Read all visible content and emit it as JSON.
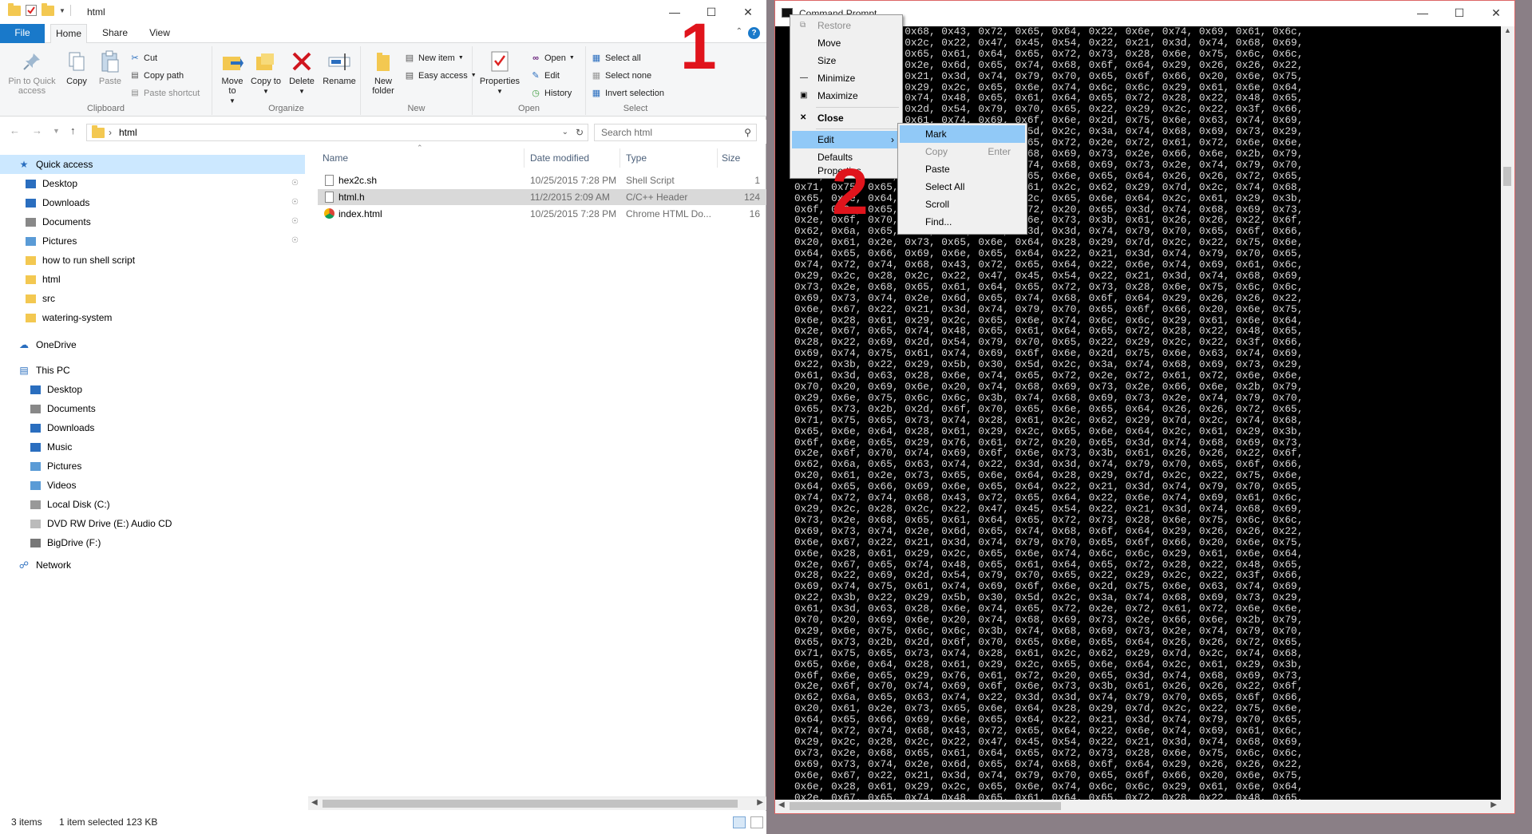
{
  "explorer": {
    "title": "html",
    "tabs": [
      "File",
      "Home",
      "Share",
      "View"
    ],
    "ribbon": {
      "clipboard": {
        "pin": "Pin to Quick access",
        "copy": "Copy",
        "paste": "Paste",
        "cut": "Cut",
        "copy_path": "Copy path",
        "paste_shortcut": "Paste shortcut",
        "label": "Clipboard"
      },
      "organize": {
        "move_to": "Move to",
        "copy_to": "Copy to",
        "delete": "Delete",
        "rename": "Rename",
        "label": "Organize"
      },
      "new": {
        "new_folder": "New folder",
        "new_item": "New item",
        "easy_access": "Easy access",
        "label": "New"
      },
      "open": {
        "properties": "Properties",
        "open": "Open",
        "edit": "Edit",
        "history": "History",
        "label": "Open"
      },
      "select": {
        "select_all": "Select all",
        "select_none": "Select none",
        "invert": "Invert selection",
        "label": "Select"
      }
    },
    "address": "html",
    "search_placeholder": "Search html",
    "nav": {
      "quick_access": "Quick access",
      "quick_items": [
        "Desktop",
        "Downloads",
        "Documents",
        "Pictures",
        "how to run shell script",
        "html",
        "src",
        "watering-system"
      ],
      "onedrive": "OneDrive",
      "this_pc": "This PC",
      "pc_items": [
        "Desktop",
        "Documents",
        "Downloads",
        "Music",
        "Pictures",
        "Videos",
        "Local Disk (C:)",
        "DVD RW Drive (E:) Audio CD",
        "BigDrive (F:)"
      ],
      "network": "Network"
    },
    "columns": [
      "Name",
      "Date modified",
      "Type",
      "Size"
    ],
    "files": [
      {
        "name": "hex2c.sh",
        "date": "10/25/2015 7:28 PM",
        "type": "Shell Script",
        "size": "1"
      },
      {
        "name": "html.h",
        "date": "11/2/2015 2:09 AM",
        "type": "C/C++ Header",
        "size": "124"
      },
      {
        "name": "index.html",
        "date": "10/25/2015 7:28 PM",
        "type": "Chrome HTML Do...",
        "size": "16"
      }
    ],
    "status": {
      "items": "3 items",
      "selected": "1 item selected  123 KB"
    }
  },
  "annotations": {
    "one": "1",
    "two": "2"
  },
  "cmd": {
    "title": "Command Prompt",
    "system_menu": [
      "Restore",
      "Move",
      "Size",
      "Minimize",
      "Maximize",
      "Close",
      "Edit",
      "Defaults",
      "Properties"
    ],
    "edit_menu": [
      "Mark",
      "Copy",
      "Paste",
      "Select All",
      "Scroll",
      "Find..."
    ],
    "copy_shortcut": "Enter",
    "hex_rows": [
      "0x74, 0x72, 0x74, 0x68, 0x43, 0x72, 0x65, 0x64, 0x22, 0x6e, 0x74, 0x69, 0x61, 0x6c,",
      "0x29, 0x2c, 0x28, 0x2c, 0x22, 0x47, 0x45, 0x54, 0x22, 0x21, 0x3d, 0x74, 0x68, 0x69,",
      "0x73, 0x2e, 0x68, 0x65, 0x61, 0x64, 0x65, 0x72, 0x73, 0x28, 0x6e, 0x75, 0x6c, 0x6c,",
      "0x69, 0x73, 0x74, 0x2e, 0x6d, 0x65, 0x74, 0x68, 0x6f, 0x64, 0x29, 0x26, 0x26, 0x22,",
      "0x6e, 0x67, 0x22, 0x21, 0x3d, 0x74, 0x79, 0x70, 0x65, 0x6f, 0x66, 0x20, 0x6e, 0x75,",
      "0x6e, 0x28, 0x61, 0x29, 0x2c, 0x65, 0x6e, 0x74, 0x6c, 0x6c, 0x29, 0x61, 0x6e, 0x64,",
      "0x2e, 0x67, 0x65, 0x74, 0x48, 0x65, 0x61, 0x64, 0x65, 0x72, 0x28, 0x22, 0x48, 0x65,",
      "0x28, 0x22, 0x69, 0x2d, 0x54, 0x79, 0x70, 0x65, 0x22, 0x29, 0x2c, 0x22, 0x3f, 0x66,",
      "0x69, 0x74, 0x75, 0x61, 0x74, 0x69, 0x6f, 0x6e, 0x2d, 0x75, 0x6e, 0x63, 0x74, 0x69,",
      "0x22, 0x3b, 0x22, 0x29, 0x5b, 0x30, 0x5d, 0x2c, 0x3a, 0x74, 0x68, 0x69, 0x73, 0x29,",
      "0x61, 0x3d, 0x63, 0x28, 0x6e, 0x74, 0x65, 0x72, 0x2e, 0x72, 0x61, 0x72, 0x6e, 0x6e,",
      "0x70, 0x20, 0x69, 0x6e, 0x20, 0x74, 0x68, 0x69, 0x73, 0x2e, 0x66, 0x6e, 0x2b, 0x79,",
      "0x29, 0x6e, 0x75, 0x6c, 0x6c, 0x3b, 0x74, 0x68, 0x69, 0x73, 0x2e, 0x74, 0x79, 0x70,",
      "0x65, 0x73, 0x2b, 0x2d, 0x6f, 0x70, 0x65, 0x6e, 0x65, 0x64, 0x26, 0x26, 0x72, 0x65,",
      "0x71, 0x75, 0x65, 0x73, 0x74, 0x28, 0x61, 0x2c, 0x62, 0x29, 0x7d, 0x2c, 0x74, 0x68,",
      "0x65, 0x6e, 0x64, 0x28, 0x61, 0x29, 0x2c, 0x65, 0x6e, 0x64, 0x2c, 0x61, 0x29, 0x3b,",
      "0x6f, 0x6e, 0x65, 0x29, 0x76, 0x61, 0x72, 0x20, 0x65, 0x3d, 0x74, 0x68, 0x69, 0x73,",
      "0x2e, 0x6f, 0x70, 0x74, 0x69, 0x6f, 0x6e, 0x73, 0x3b, 0x61, 0x26, 0x26, 0x22, 0x6f,",
      "0x62, 0x6a, 0x65, 0x63, 0x74, 0x22, 0x3d, 0x3d, 0x74, 0x79, 0x70, 0x65, 0x6f, 0x66,",
      "0x20, 0x61, 0x2e, 0x73, 0x65, 0x6e, 0x64, 0x28, 0x29, 0x7d, 0x2c, 0x22, 0x75, 0x6e,",
      "0x64, 0x65, 0x66, 0x69, 0x6e, 0x65, 0x64, 0x22, 0x21, 0x3d, 0x74, 0x79, 0x70, 0x65,"
    ]
  }
}
